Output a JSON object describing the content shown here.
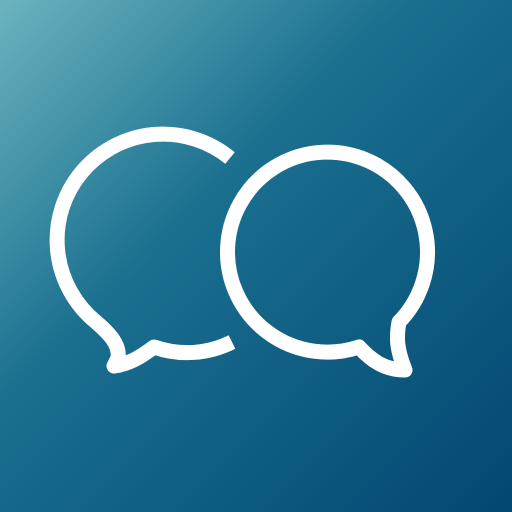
{
  "icon": {
    "name": "chat-bubbles-logo",
    "colors": {
      "gradient_start": "#6bb4bf",
      "gradient_mid": "#1a6f8f",
      "gradient_end": "#024772",
      "stroke": "#ffffff"
    }
  }
}
